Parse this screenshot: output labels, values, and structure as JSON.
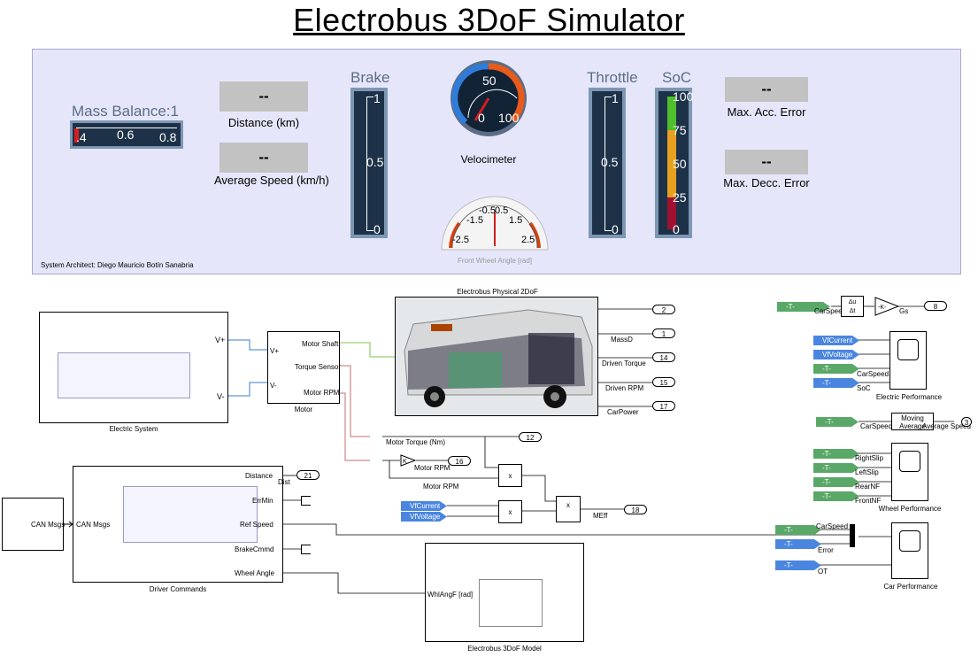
{
  "title": "Electrobus 3DoF Simulator",
  "dashboard": {
    "mass_balance": {
      "label": "Mass Balance:1",
      "ticks": [
        ".4",
        "0.6",
        "0.8"
      ]
    },
    "distance": {
      "value": "--",
      "label": "Distance (km)"
    },
    "average_speed": {
      "value": "--",
      "label": "Average Speed (km/h)"
    },
    "brake": {
      "title": "Brake",
      "ticks": [
        "1",
        "0.5",
        "0"
      ]
    },
    "velocimeter": {
      "label": "Velocimeter",
      "ticks": [
        "0",
        "50",
        "100"
      ]
    },
    "front_wheel": {
      "label": "Front Wheel Angle [rad]",
      "ticks": [
        "-2.5",
        "-1.5",
        "-0.5",
        "0.5",
        "1.5",
        "2.5"
      ]
    },
    "throttle": {
      "title": "Throttle",
      "ticks": [
        "1",
        "0.5",
        "0"
      ]
    },
    "soc": {
      "title": "SoC",
      "ticks": [
        "100",
        "75",
        "50",
        "25",
        "0"
      ]
    },
    "max_acc_error": {
      "value": "--",
      "label": "Max. Acc. Error"
    },
    "max_decc_error": {
      "value": "--",
      "label": "Max. Decc. Error"
    },
    "architect": "System Architect: Diego Mauricio Botín Sanabria"
  },
  "blocks": {
    "electric_system": {
      "label": "Electric System",
      "ports": [
        "V+",
        "V-"
      ]
    },
    "motor": {
      "label": "Motor",
      "inputs": [
        "V+",
        "V-"
      ],
      "outputs": [
        "Motor Shaft",
        "Torque Sensor",
        "Motor RPM"
      ]
    },
    "physical": {
      "title": "Electrobus Physical 2DoF",
      "outputs": [
        "MassD",
        "Driven Torque",
        "Driven RPM",
        "CarPower"
      ]
    },
    "driver": {
      "label": "Driver Commands",
      "input": "CAN Msgs",
      "outputs": [
        "Distance",
        "ErrMin",
        "Ref Speed",
        "BrakeCmmd",
        "Wheel Angle"
      ]
    },
    "can": {
      "label": "CAN Msgs"
    },
    "model3dof": {
      "label": "Electrobus 3DoF Model",
      "input": "WhlAngF [rad]"
    },
    "signals": {
      "motor_torque": "Motor Torque (Nm)",
      "motor_rpm": "Motor RPM",
      "gain": "K",
      "mult": "x",
      "meff": "MEff",
      "dist": "Dist",
      "v_current": "VfCurrent",
      "v_voltage": "VfVoltage"
    },
    "ports": [
      "2",
      "1",
      "14",
      "15",
      "17",
      "12",
      "16",
      "21",
      "18",
      "8",
      "3"
    ],
    "gs": {
      "from": "CarSpeed",
      "deriv_top": "Δu",
      "deriv_bot": "Δt",
      "gain": "-K-",
      "out": "Gs"
    },
    "electric_perf": {
      "label": "Electric Performance",
      "tags": [
        "VfCurrent",
        "VfVoltage",
        "-T-",
        "-T-"
      ],
      "signals": [
        "CarSpeed",
        "SoC"
      ]
    },
    "moving_avg": {
      "from": "CarSpeed",
      "block": "Moving Average",
      "out": "Average Speed"
    },
    "wheel_perf": {
      "label": "Wheel Performance",
      "signals": [
        "RightSlip",
        "LeftSlip",
        "RearNF",
        "FrontNF"
      ]
    },
    "car_perf": {
      "label": "Car Performance",
      "signals": [
        "CarSpeed",
        "Error",
        "OT"
      ]
    },
    "goto": "-T-"
  }
}
